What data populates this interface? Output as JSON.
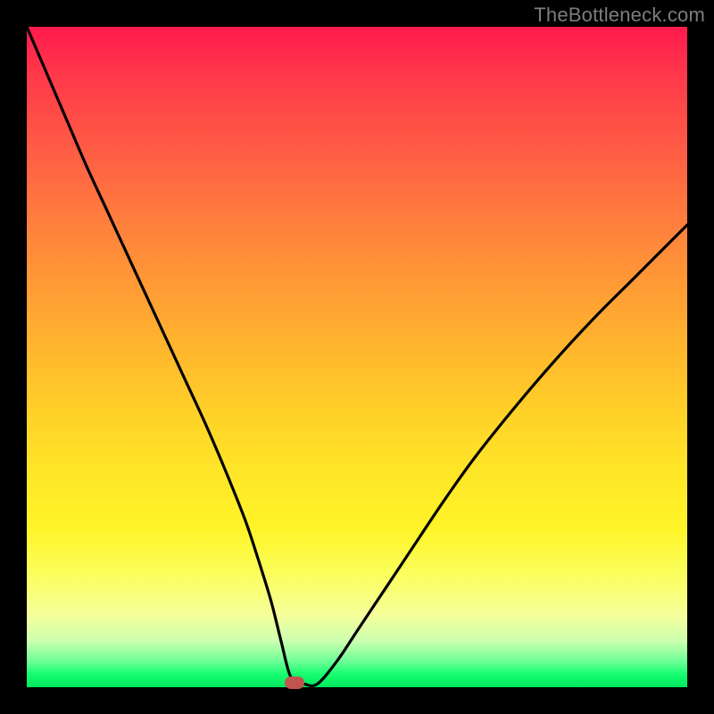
{
  "watermark": "TheBottleneck.com",
  "colors": {
    "frame": "#000000",
    "curve": "#000000",
    "marker": "#c1544d"
  },
  "chart_data": {
    "type": "line",
    "title": "",
    "xlabel": "",
    "ylabel": "",
    "xlim": [
      0,
      100
    ],
    "ylim": [
      0,
      100
    ],
    "grid": false,
    "legend": false,
    "series": [
      {
        "name": "bottleneck-curve",
        "x": [
          0,
          3,
          6,
          9,
          12,
          15,
          18,
          21,
          24,
          27,
          30,
          33,
          35,
          37,
          38.5,
          40,
          42,
          44,
          47,
          50,
          54,
          58,
          63,
          68,
          74,
          80,
          86,
          92,
          100
        ],
        "y": [
          100,
          93,
          86,
          79,
          72.5,
          66,
          59.5,
          53,
          46.5,
          40,
          33,
          25.5,
          19.5,
          13,
          7,
          1.5,
          0.5,
          0.5,
          4,
          8.5,
          14.5,
          20.5,
          28,
          35,
          42.5,
          49.5,
          56,
          62,
          70
        ]
      }
    ],
    "marker": {
      "x": 40.5,
      "y": 0.7
    },
    "gradient_stops": [
      {
        "pos": 0,
        "color": "#ff1a4d"
      },
      {
        "pos": 18,
        "color": "#ff5a45"
      },
      {
        "pos": 38,
        "color": "#ff9736"
      },
      {
        "pos": 58,
        "color": "#ffd028"
      },
      {
        "pos": 76,
        "color": "#fff428"
      },
      {
        "pos": 89,
        "color": "#f5ff9a"
      },
      {
        "pos": 96,
        "color": "#70ff98"
      },
      {
        "pos": 100,
        "color": "#00e85e"
      }
    ]
  }
}
